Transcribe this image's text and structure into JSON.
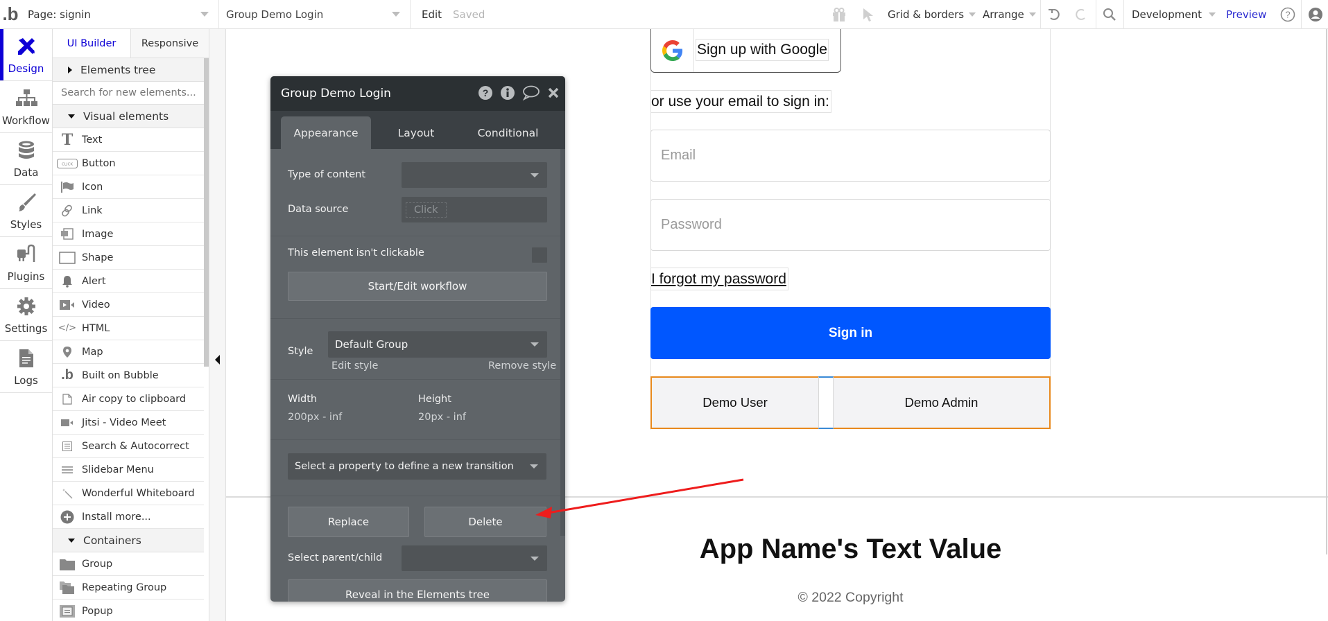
{
  "topbar": {
    "logo": ".b",
    "page_selector": "Page: signin",
    "element_selector": "Group Demo Login",
    "edit_label": "Edit",
    "save_status": "Saved",
    "grid_borders": "Grid & borders",
    "arrange": "Arrange",
    "environment": "Development",
    "preview": "Preview"
  },
  "leftnav": {
    "items": [
      {
        "label": "Design",
        "icon": "design-icon",
        "active": true
      },
      {
        "label": "Workflow",
        "icon": "workflow-icon"
      },
      {
        "label": "Data",
        "icon": "database-icon"
      },
      {
        "label": "Styles",
        "icon": "brush-icon"
      },
      {
        "label": "Plugins",
        "icon": "plugin-icon"
      },
      {
        "label": "Settings",
        "icon": "gear-icon"
      },
      {
        "label": "Logs",
        "icon": "document-icon"
      }
    ],
    "accent_color": "#0d00d6"
  },
  "palette": {
    "tabs": [
      "UI Builder",
      "Responsive"
    ],
    "elements_tree": "Elements tree",
    "search_placeholder": "Search for new elements...",
    "visual_section": "Visual elements",
    "visual_items": [
      {
        "label": "Text",
        "icon": "text-icon"
      },
      {
        "label": "Button",
        "icon": "button-icon"
      },
      {
        "label": "Icon",
        "icon": "flag-icon"
      },
      {
        "label": "Link",
        "icon": "link-icon"
      },
      {
        "label": "Image",
        "icon": "image-icon"
      },
      {
        "label": "Shape",
        "icon": "shape-icon"
      },
      {
        "label": "Alert",
        "icon": "bell-icon"
      },
      {
        "label": "Video",
        "icon": "video-icon"
      },
      {
        "label": "HTML",
        "icon": "code-icon"
      },
      {
        "label": "Map",
        "icon": "map-pin-icon"
      },
      {
        "label": "Built on Bubble",
        "icon": "bubble-logo-icon"
      },
      {
        "label": "Air copy to clipboard",
        "icon": "clipboard-icon"
      },
      {
        "label": "Jitsi - Video Meet",
        "icon": "camera-icon"
      },
      {
        "label": "Search & Autocorrect",
        "icon": "list-icon"
      },
      {
        "label": "Slidebar Menu",
        "icon": "menu-icon"
      },
      {
        "label": "Wonderful Whiteboard",
        "icon": "magic-wand-icon"
      },
      {
        "label": "Install more...",
        "icon": "plus-circle-icon"
      }
    ],
    "containers_section": "Containers",
    "container_items": [
      {
        "label": "Group",
        "icon": "folder-icon"
      },
      {
        "label": "Repeating Group",
        "icon": "folders-icon"
      },
      {
        "label": "Popup",
        "icon": "popup-icon"
      }
    ]
  },
  "property_editor": {
    "title": "Group Demo Login",
    "tabs": [
      "Appearance",
      "Layout",
      "Conditional"
    ],
    "active_tab": "Appearance",
    "type_of_content_label": "Type of content",
    "type_of_content_value": "",
    "data_source_label": "Data source",
    "data_source_placeholder": "Click",
    "not_clickable_label": "This element isn't clickable",
    "not_clickable_checked": false,
    "workflow_button": "Start/Edit workflow",
    "style_label": "Style",
    "style_value": "Default Group",
    "edit_style": "Edit style",
    "remove_style": "Remove style",
    "width_label": "Width",
    "width_value": "200px - inf",
    "height_label": "Height",
    "height_value": "20px - inf",
    "transition_placeholder": "Select a property to define a new transition",
    "replace_button": "Replace",
    "delete_button": "Delete",
    "parent_child_label": "Select parent/child",
    "reveal_button": "Reveal in the Elements tree"
  },
  "canvas": {
    "google_button": "Sign up with Google",
    "or_text": "or use your email to sign in:",
    "email_placeholder": "Email",
    "password_placeholder": "Password",
    "forgot_link": "I forgot my password",
    "signin_button": "Sign in",
    "demo_user": "Demo User",
    "demo_admin": "Demo Admin",
    "app_title": "App Name's Text Value",
    "copyright": "© 2022 Copyright",
    "signin_color": "#0057ff",
    "selection_color": "#e8891d"
  },
  "annotation": {
    "arrow_color": "#ee1c1c",
    "points_to": "Delete"
  }
}
